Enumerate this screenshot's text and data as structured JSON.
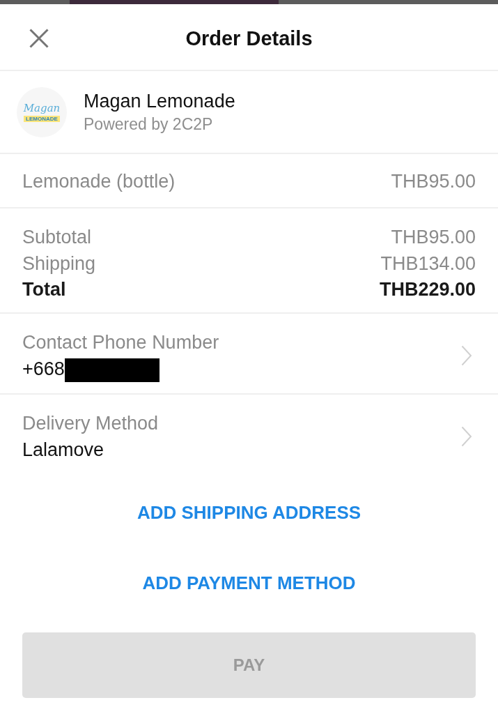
{
  "header": {
    "title": "Order Details"
  },
  "merchant": {
    "logo": {
      "script": "Magan",
      "tag": "LEMONADE"
    },
    "name": "Magan Lemonade",
    "subtitle": "Powered by 2C2P"
  },
  "items": [
    {
      "name": "Lemonade (bottle)",
      "price": "THB95.00"
    }
  ],
  "summary": [
    {
      "kind": "line",
      "label": "Subtotal",
      "amount": "THB95.00"
    },
    {
      "kind": "line",
      "label": "Shipping",
      "amount": "THB134.00"
    },
    {
      "kind": "total",
      "label": "Total",
      "amount": "THB229.00"
    }
  ],
  "details": [
    {
      "label": "Contact Phone Number",
      "value": "+668",
      "redacted": true
    },
    {
      "label": "Delivery Method",
      "value": "Lalamove",
      "redacted": false
    }
  ],
  "actions": [
    "ADD SHIPPING ADDRESS",
    "ADD PAYMENT METHOD"
  ],
  "pay_button": {
    "label": "PAY",
    "disabled": true
  }
}
